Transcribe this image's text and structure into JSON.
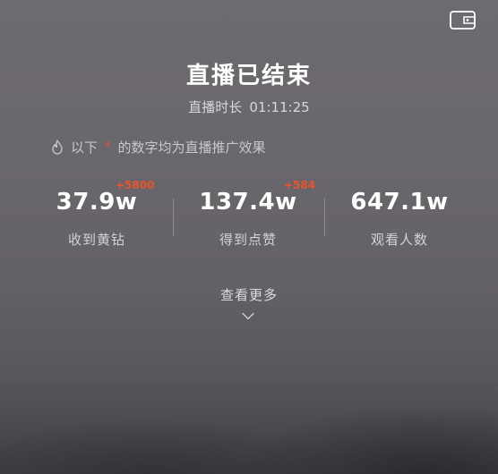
{
  "header": {
    "wallet_icon": "wallet-icon"
  },
  "summary": {
    "title": "直播已结束",
    "duration_label": "直播时长",
    "duration_value": "01:11:25"
  },
  "promo_note": {
    "icon": "fire-icon",
    "prefix": "以下",
    "marker": "*",
    "suffix": "的数字均为直播推广效果",
    "accent_color": "#e8552c"
  },
  "stats": [
    {
      "value": "37.9w",
      "delta": "+5800",
      "label": "收到黄钻"
    },
    {
      "value": "137.4w",
      "delta": "+584",
      "label": "得到点赞"
    },
    {
      "value": "647.1w",
      "label": "观看人数"
    }
  ],
  "more": {
    "label": "查看更多",
    "icon": "chevron-down-icon"
  }
}
